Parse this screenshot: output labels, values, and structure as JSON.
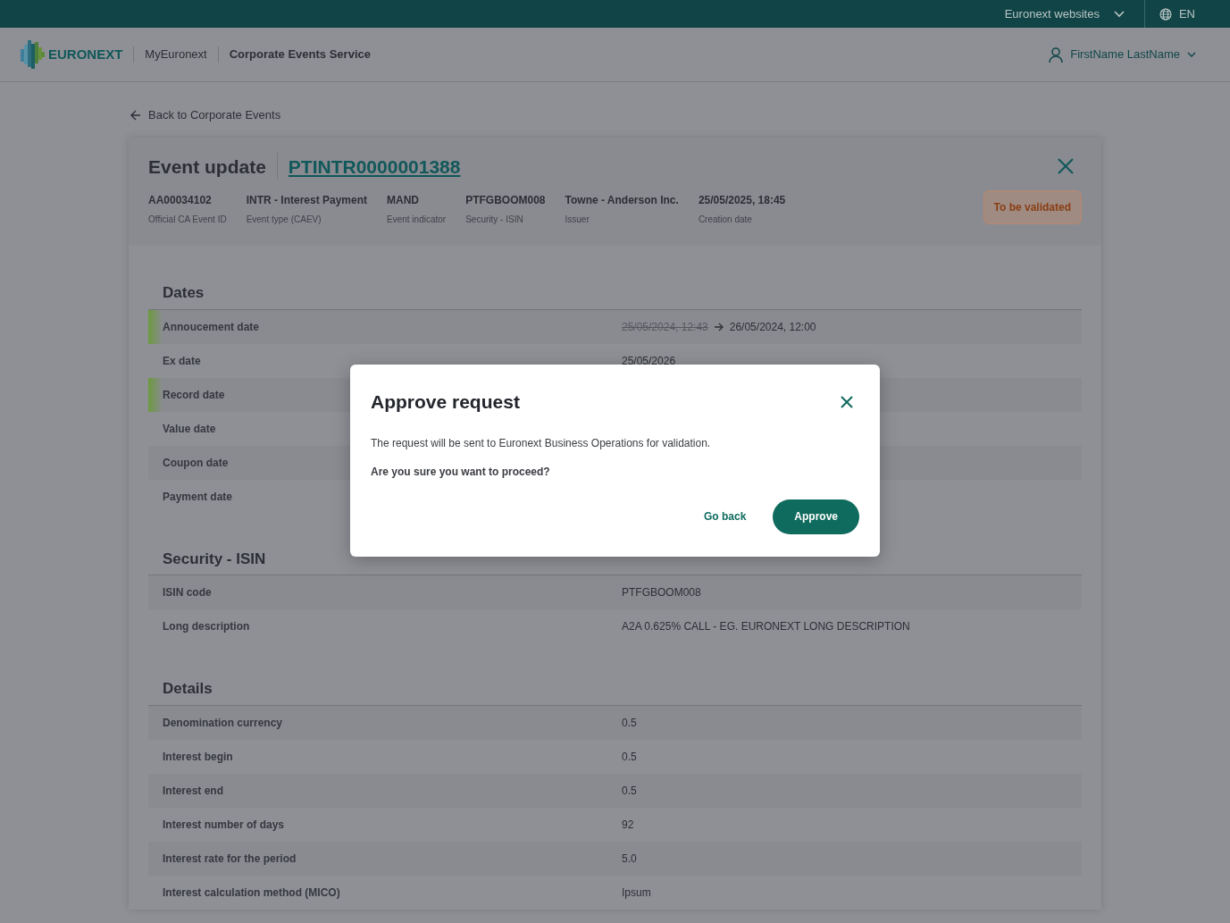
{
  "top_bar": {
    "websites": "Euronext websites",
    "language": "EN"
  },
  "header": {
    "logo": "EURONEXT",
    "app": "MyEuronext",
    "service": "Corporate Events Service",
    "user": "FirstName LastName"
  },
  "back_link": "Back to Corporate Events",
  "event": {
    "title": "Event update",
    "reference": "PTINTR0000001388",
    "status": "To be validated",
    "facts": [
      {
        "value": "AA00034102",
        "label": "Official CA Event ID"
      },
      {
        "value": "INTR - Interest Payment",
        "label": "Event type (CAEV)"
      },
      {
        "value": "MAND",
        "label": "Event indicator"
      },
      {
        "value": "PTFGBOOM008",
        "label": "Security - ISIN"
      },
      {
        "value": "Towne - Anderson Inc.",
        "label": "Issuer"
      },
      {
        "value": "25/05/2025, 18:45",
        "label": "Creation date"
      }
    ]
  },
  "sections": [
    {
      "title": "Dates",
      "rows": [
        {
          "label": "Annoucement date",
          "changed": true,
          "old_value": "25/05/2024, 12:43",
          "value": "26/05/2024, 12:00"
        },
        {
          "label": "Ex date",
          "changed": false,
          "value": "25/05/2026"
        },
        {
          "label": "Record date",
          "changed": true
        },
        {
          "label": "Value date",
          "changed": false
        },
        {
          "label": "Coupon date",
          "changed": false
        },
        {
          "label": "Payment date",
          "changed": false
        }
      ]
    },
    {
      "title": "Security - ISIN",
      "rows": [
        {
          "label": "ISIN code",
          "changed": false,
          "value": "PTFGBOOM008"
        },
        {
          "label": "Long description",
          "changed": false,
          "value": "A2A 0.625% CALL - EG. EURONEXT LONG DESCRIPTION"
        }
      ]
    },
    {
      "title": "Details",
      "rows": [
        {
          "label": "Denomination currency",
          "changed": false,
          "value": "0.5"
        },
        {
          "label": "Interest begin",
          "changed": false,
          "value": "0.5"
        },
        {
          "label": "Interest end",
          "changed": false,
          "value": "0.5"
        },
        {
          "label": "Interest number of days",
          "changed": false,
          "value": "92"
        },
        {
          "label": "Interest rate for the period",
          "changed": false,
          "value": "5.0"
        },
        {
          "label": "Interest calculation method (MICO)",
          "changed": false,
          "value": "Ipsum"
        }
      ]
    }
  ],
  "dialog": {
    "title": "Approve request",
    "message": "The request will be sent to Euronext Business Operations for validation.",
    "question": "Are you sure you want to proceed?",
    "buttons": [
      {
        "label": "Go back",
        "kind": "secondary"
      },
      {
        "label": "Approve",
        "kind": "primary"
      }
    ]
  }
}
